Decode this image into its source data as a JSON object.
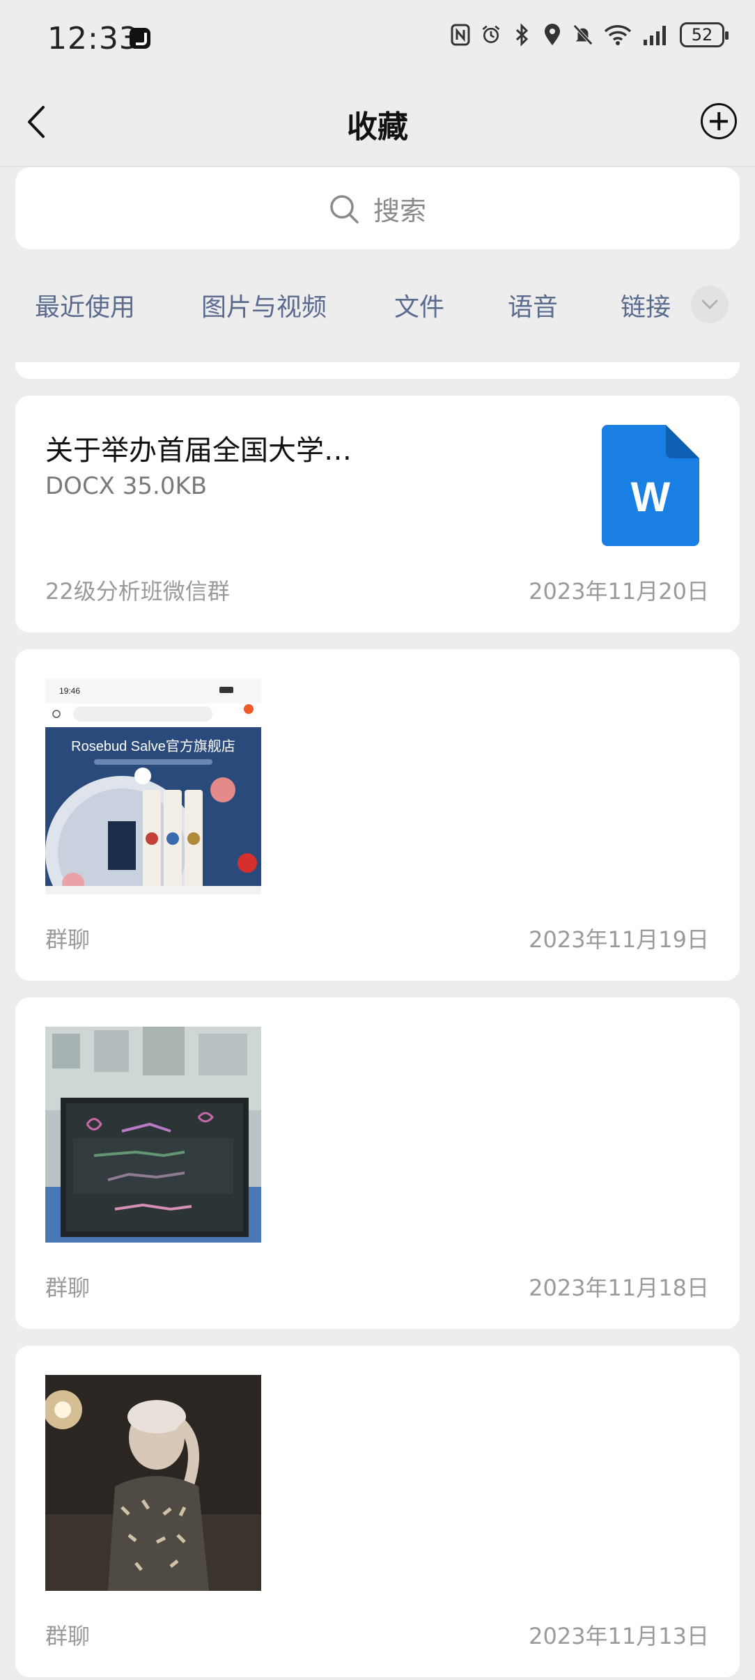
{
  "status_bar": {
    "time": "12:33",
    "battery": "52",
    "icons": [
      "nfc-icon",
      "alarm-icon",
      "bluetooth-icon",
      "location-icon",
      "mute-icon",
      "wifi-icon",
      "signal-icon"
    ]
  },
  "header": {
    "title": "收藏"
  },
  "search": {
    "placeholder": "搜索"
  },
  "tabs": [
    {
      "label": "最近使用"
    },
    {
      "label": "图片与视频"
    },
    {
      "label": "文件"
    },
    {
      "label": "语音"
    },
    {
      "label": "链接"
    }
  ],
  "items": [
    {
      "type": "file",
      "title": "关于举办首届全国大学生职业规划…",
      "meta": "DOCX 35.0KB",
      "file_icon_letter": "W",
      "source": "22级分析班微信群",
      "date": "2023年11月20日"
    },
    {
      "type": "image",
      "thumb_time": "19:46",
      "thumb_store": "Rosebud Salve官方旗舰店",
      "source": "群聊",
      "date": "2023年11月19日"
    },
    {
      "type": "image",
      "source": "群聊",
      "date": "2023年11月18日"
    },
    {
      "type": "image",
      "source": "群聊",
      "date": "2023年11月13日"
    }
  ],
  "colors": {
    "background": "#ededed",
    "tab_text": "#5b6b8e",
    "word_blue": "#1a7fe3",
    "meta_gray": "#9a9a9a"
  }
}
